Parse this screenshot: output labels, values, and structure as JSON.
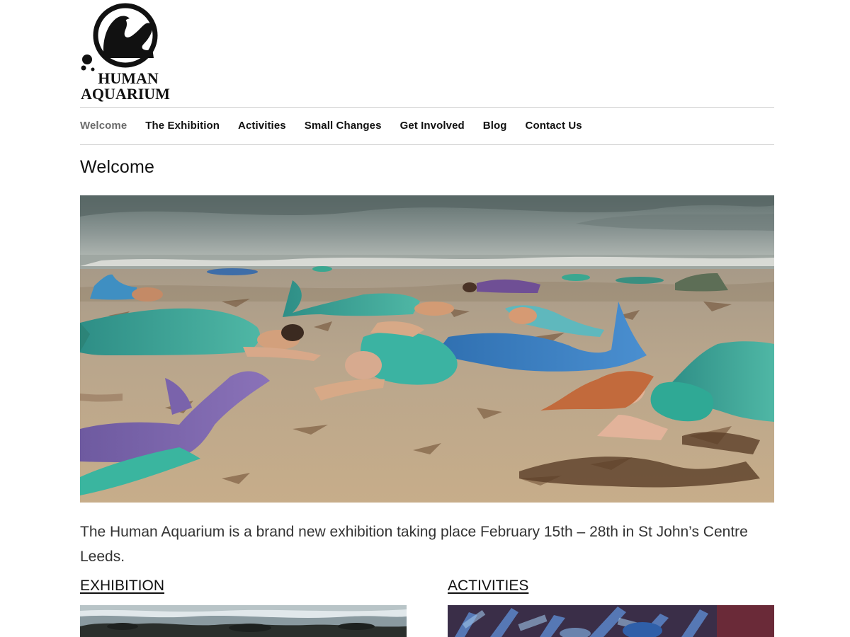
{
  "site": {
    "logo_line1": "HUMAN",
    "logo_line2": "AQUARIUM"
  },
  "nav": {
    "items": [
      {
        "label": "Welcome",
        "active": true
      },
      {
        "label": "The Exhibition",
        "active": false
      },
      {
        "label": "Activities",
        "active": false
      },
      {
        "label": "Small Changes",
        "active": false
      },
      {
        "label": "Get Involved",
        "active": false
      },
      {
        "label": "Blog",
        "active": false
      },
      {
        "label": "Contact Us",
        "active": false
      }
    ]
  },
  "page": {
    "title": "Welcome",
    "intro": "The Human Aquarium is a brand new exhibition taking place February 15th – 28th in St John’s Centre Leeds."
  },
  "sections": [
    {
      "heading": "EXHIBITION"
    },
    {
      "heading": "ACTIVITIES"
    }
  ],
  "colors": {
    "nav_active": "#6a6a6a",
    "text": "#111111",
    "rule": "#cfcfcf"
  }
}
